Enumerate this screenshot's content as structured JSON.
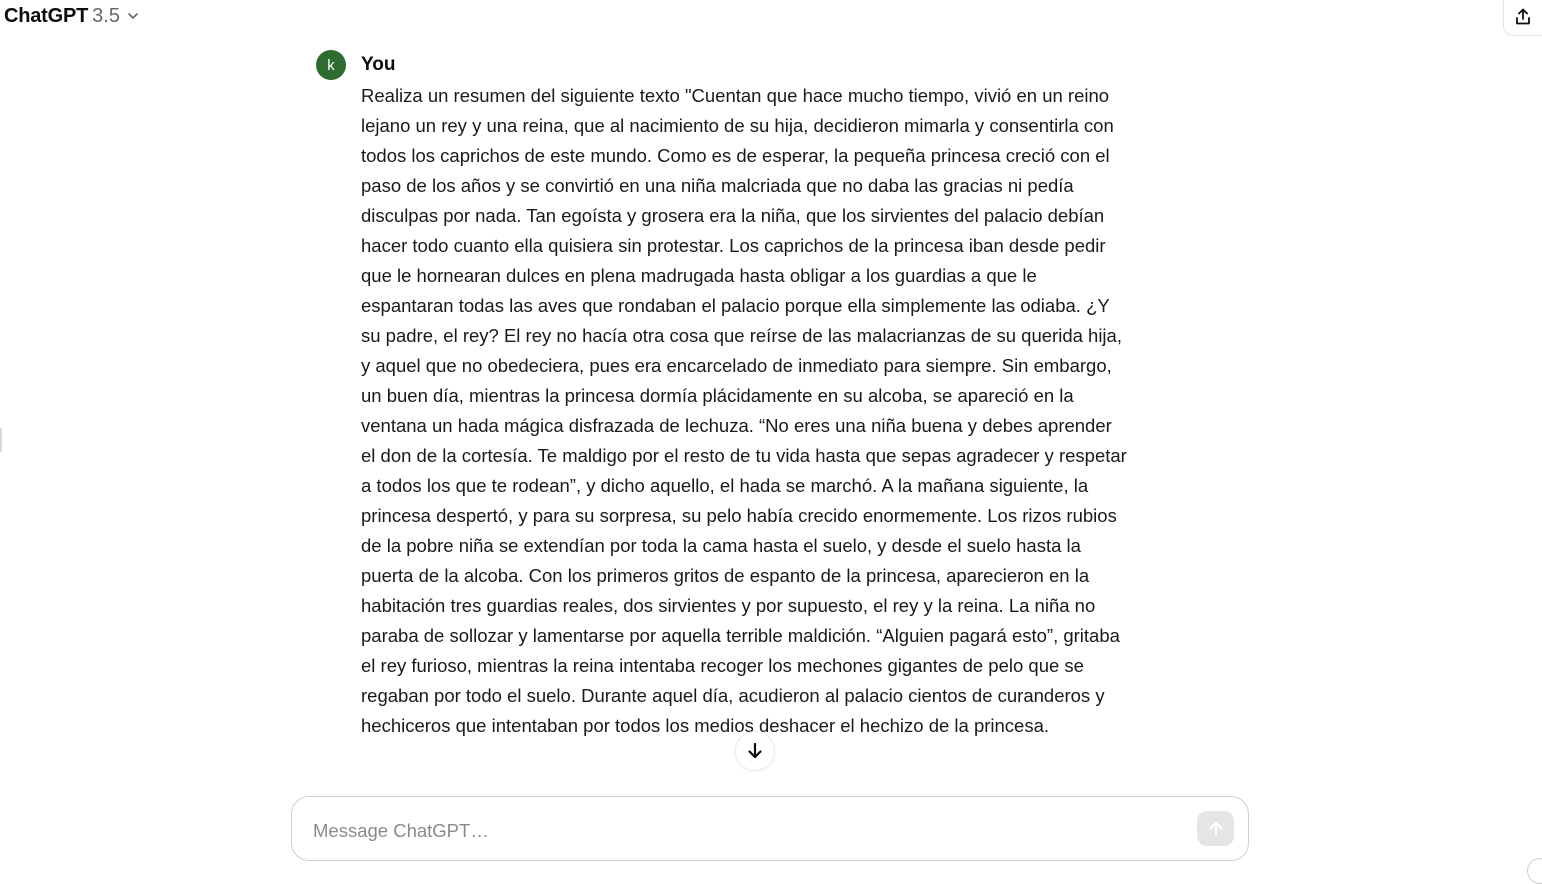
{
  "header": {
    "model_name": "ChatGPT",
    "model_version": "3.5",
    "model_dropdown_icon": "chevron-down-icon",
    "share_icon": "share-icon"
  },
  "message": {
    "avatar_initial": "k",
    "author": "You",
    "text": "Realiza un resumen del siguiente texto \"Cuentan que hace mucho tiempo, vivió en un reino lejano un rey y una reina, que al nacimiento de su hija, decidieron mimarla y consentirla con todos los caprichos de este mundo. Como es de esperar, la pequeña princesa creció con el paso de los años y se convirtió en una niña malcriada que no daba las gracias ni pedía disculpas por nada. Tan egoísta y grosera era la niña, que los sirvientes del palacio debían hacer todo cuanto ella quisiera sin protestar. Los caprichos de la princesa iban desde pedir que le hornearan dulces en plena madrugada hasta obligar a los guardias a que le espantaran todas las aves que rondaban el palacio porque ella simplemente las odiaba. ¿Y su padre, el rey? El rey no hacía otra cosa que reírse de las malacrianzas de su querida hija, y aquel que no obedeciera, pues era encarcelado de inmediato para siempre. Sin embargo, un buen día, mientras la princesa dormía plácidamente en su alcoba, se apareció en la ventana un hada mágica disfrazada de lechuza. “No eres una niña buena y debes aprender el don de la cortesía. Te maldigo por el resto de tu vida hasta que sepas agradecer y respetar a todos los que te rodean”, y dicho aquello, el hada se marchó. A la mañana siguiente, la princesa despertó, y para su sorpresa, su pelo había crecido enormemente. Los rizos rubios de la pobre niña se extendían por toda la cama hasta el suelo, y desde el suelo hasta la puerta de la alcoba. Con los primeros gritos de espanto de la princesa, aparecieron en la habitación tres guardias reales, dos sirvientes y por supuesto, el rey y la reina. La niña no paraba de sollozar y lamentarse por aquella terrible maldición. “Alguien pagará esto”, gritaba el rey furioso, mientras la reina intentaba recoger los mechones gigantes de pelo que se regaban por todo el suelo. Durante aquel día, acudieron al palacio cientos de curanderos y hechiceros que intentaban por todos los medios deshacer el hechizo de la princesa."
  },
  "scroll_down_icon": "arrow-down-icon",
  "composer": {
    "placeholder": "Message ChatGPT…",
    "value": "",
    "send_icon": "arrow-up-icon"
  },
  "colors": {
    "avatar_bg": "#2e6b2e",
    "send_button_bg": "#e5e5e5",
    "text": "#0d0d0d",
    "muted": "#676767"
  }
}
